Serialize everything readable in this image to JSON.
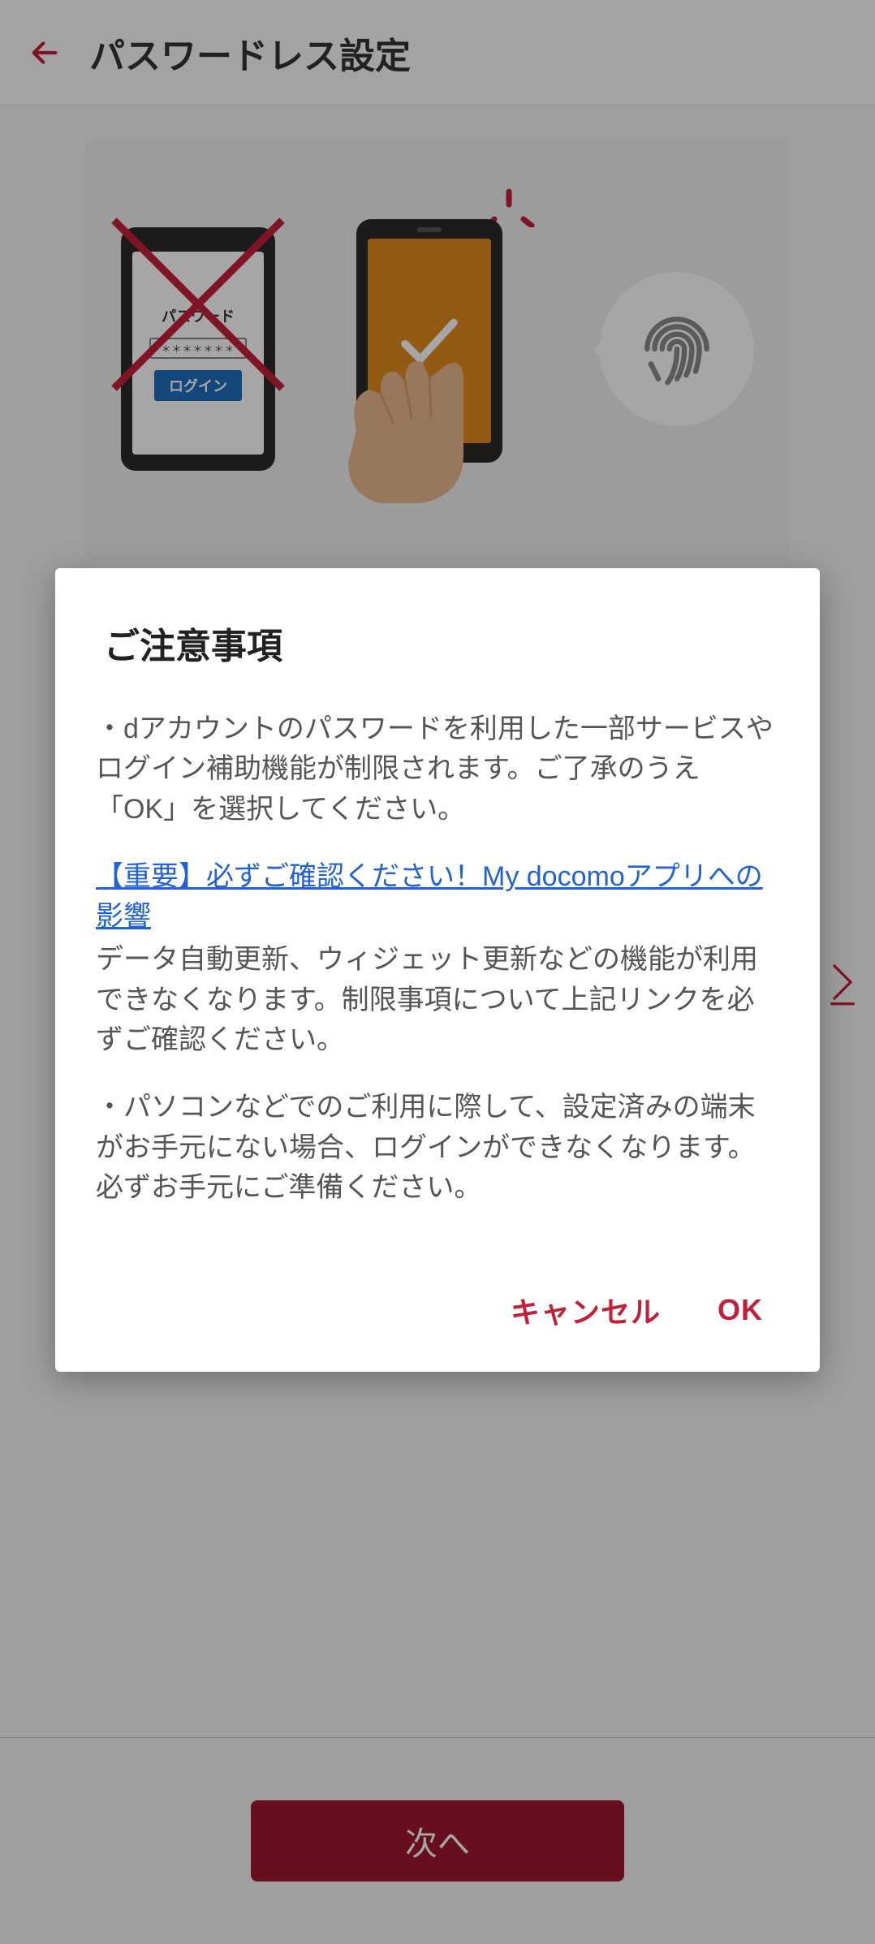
{
  "header": {
    "title": "パスワードレス設定"
  },
  "illustration": {
    "password_label": "パスワード",
    "password_masked": "＊＊＊＊＊＊＊",
    "login_button": "ログイン"
  },
  "bottom": {
    "next": "次へ"
  },
  "dialog": {
    "title": "ご注意事項",
    "para1": "・dアカウントのパスワードを利用した一部サービスやログイン補助機能が制限されます。ご了承のうえ「OK」を選択してください。",
    "link_text": "【重要】必ずご確認ください！My docomoアプリへの影響",
    "para2": "データ自動更新、ウィジェット更新などの機能が利用できなくなります。制限事項について上記リンクを必ずご確認ください。",
    "para3": "・パソコンなどでのご利用に際して、設定済みの端末がお手元にない場合、ログインができなくなります。必ずお手元にご準備ください。",
    "cancel": "キャンセル",
    "ok": "OK"
  }
}
